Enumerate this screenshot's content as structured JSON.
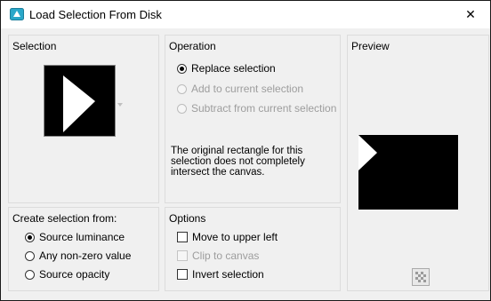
{
  "window": {
    "title": "Load Selection From Disk",
    "close_glyph": "✕",
    "app_icon": "paint-app-icon"
  },
  "selection_group": {
    "title": "Selection"
  },
  "operation_group": {
    "title": "Operation",
    "options": [
      {
        "label": "Replace selection",
        "checked": true,
        "enabled": true
      },
      {
        "label": "Add to current selection",
        "checked": false,
        "enabled": false
      },
      {
        "label": "Subtract from current selection",
        "checked": false,
        "enabled": false
      }
    ],
    "message": "The original rectangle for this selection does not completely intersect the canvas."
  },
  "preview_group": {
    "title": "Preview"
  },
  "create_group": {
    "title": "Create selection from:",
    "options": [
      {
        "label": "Source luminance",
        "checked": true
      },
      {
        "label": "Any non-zero value",
        "checked": false
      },
      {
        "label": "Source opacity",
        "checked": false
      }
    ]
  },
  "options_group": {
    "title": "Options",
    "checks": [
      {
        "label": "Move to upper left",
        "checked": false,
        "enabled": true
      },
      {
        "label": "Clip to canvas",
        "checked": false,
        "enabled": false
      },
      {
        "label": "Invert selection",
        "checked": false,
        "enabled": true
      }
    ]
  },
  "colors": {
    "title_bg": "#ffffff",
    "dialog_bg": "#f0f0f0",
    "icon_blue": "#2aa7c9"
  }
}
